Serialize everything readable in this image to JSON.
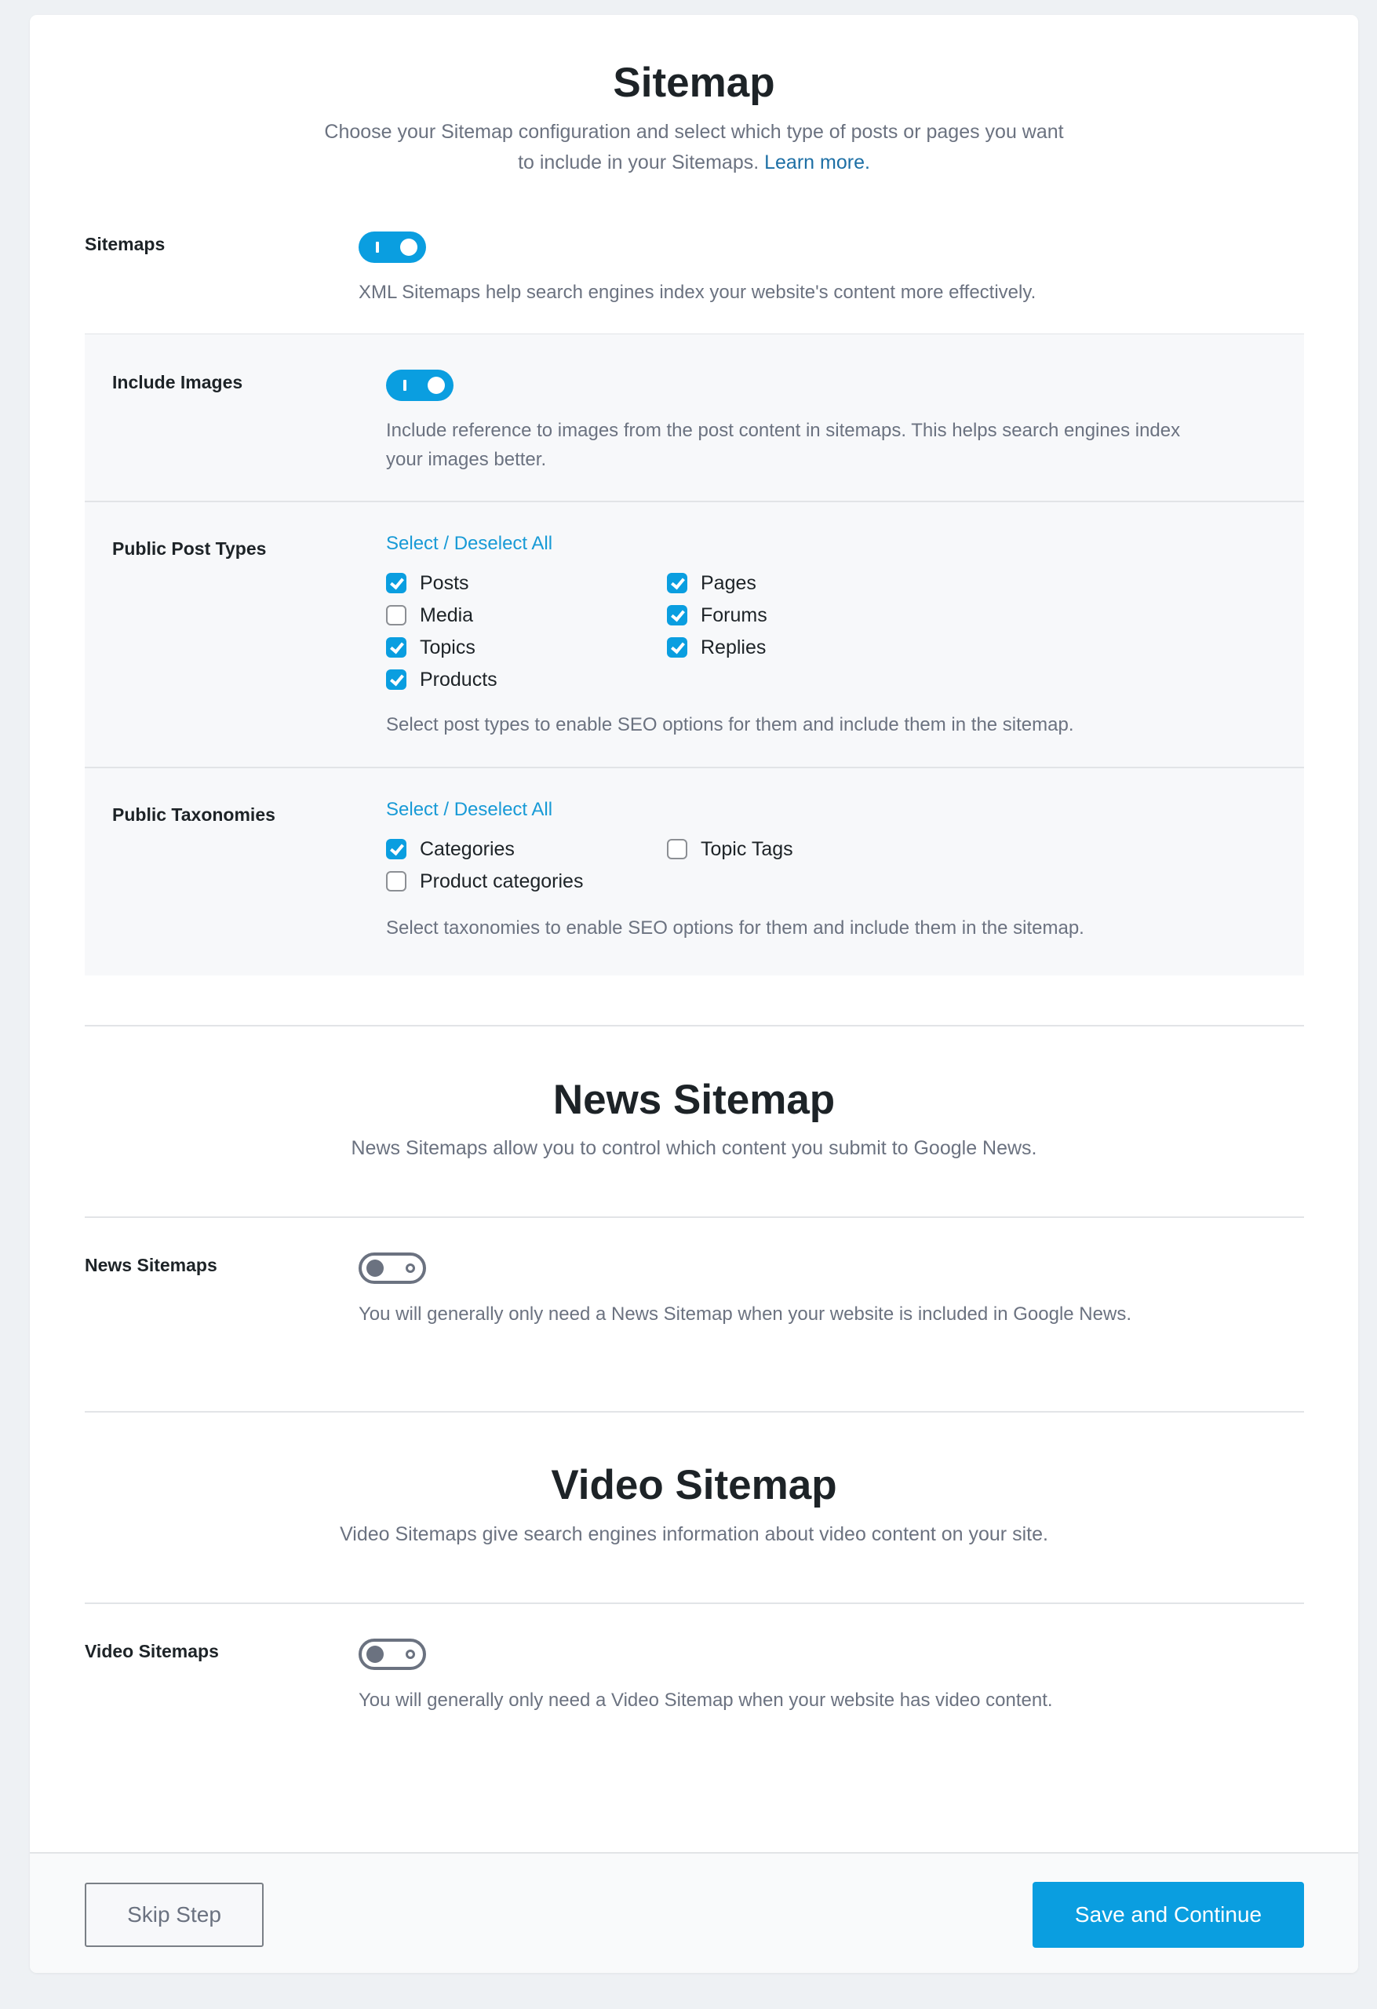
{
  "sitemap": {
    "title": "Sitemap",
    "description_line1": "Choose your Sitemap configuration and select which type of posts or pages you want",
    "description_line2": "to include in your Sitemaps.",
    "learn_more": "Learn more.",
    "sitemaps": {
      "label": "Sitemaps",
      "enabled": true,
      "help": "XML Sitemaps help search engines index your website's content more effectively."
    },
    "include_images": {
      "label": "Include Images",
      "enabled": true,
      "help_line1": "Include reference to images from the post content in sitemaps. This helps search engines index",
      "help_line2": "your images better."
    },
    "post_types": {
      "label": "Public Post Types",
      "select_all": "Select / Deselect All",
      "items": [
        {
          "label": "Posts",
          "checked": true
        },
        {
          "label": "Media",
          "checked": false
        },
        {
          "label": "Topics",
          "checked": true
        },
        {
          "label": "Products",
          "checked": true
        },
        {
          "label": "Pages",
          "checked": true
        },
        {
          "label": "Forums",
          "checked": true
        },
        {
          "label": "Replies",
          "checked": true
        }
      ],
      "help": "Select post types to enable SEO options for them and include them in the sitemap."
    },
    "taxonomies": {
      "label": "Public Taxonomies",
      "select_all": "Select / Deselect All",
      "items": [
        {
          "label": "Categories",
          "checked": true
        },
        {
          "label": "Product categories",
          "checked": false
        },
        {
          "label": "Topic Tags",
          "checked": false
        }
      ],
      "help": "Select taxonomies to enable SEO options for them and include them in the sitemap."
    }
  },
  "news": {
    "title": "News Sitemap",
    "description": "News Sitemaps allow you to control which content you submit to Google News.",
    "label": "News Sitemaps",
    "enabled": false,
    "help": "You will generally only need a News Sitemap when your website is included in Google News."
  },
  "video": {
    "title": "Video Sitemap",
    "description": "Video Sitemaps give search engines information about video content on your site.",
    "label": "Video Sitemaps",
    "enabled": false,
    "help": "You will generally only need a Video Sitemap when your website has video content."
  },
  "footer": {
    "skip_label": "Skip Step",
    "save_label": "Save and Continue"
  },
  "colors": {
    "accent": "#0a9ee0",
    "link": "#189ad6",
    "learn_more_link": "#1d6fa5",
    "page_bg": "#eef1f4",
    "group_bg": "#f7f8fa",
    "toggle_off": "#6b7280"
  }
}
